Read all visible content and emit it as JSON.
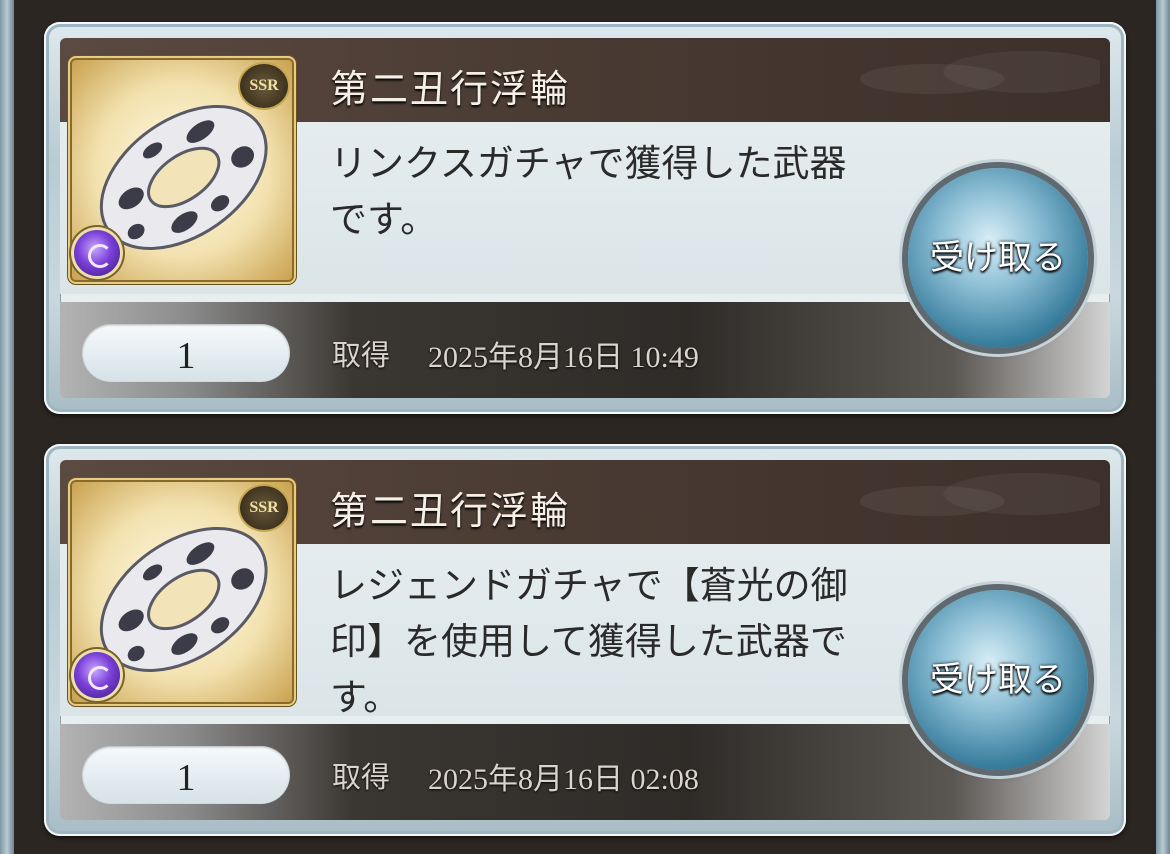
{
  "items": [
    {
      "name": "第二丑行浮輪",
      "rarity": "SSR",
      "element_icon": "dark-element-icon",
      "description": "リンクスガチャで獲得した武器です。",
      "quantity": "1",
      "obtain_label": "取得",
      "obtain_date": "2025年8月16日 10:49",
      "button_label": "受け取る"
    },
    {
      "name": "第二丑行浮輪",
      "rarity": "SSR",
      "element_icon": "dark-element-icon",
      "description": "レジェンドガチャで【蒼光の御印】を使用して獲得した武器です。",
      "quantity": "1",
      "obtain_label": "取得",
      "obtain_date": "2025年8月16日 02:08",
      "button_label": "受け取る"
    }
  ],
  "colors": {
    "title_bar": "#4a3b33",
    "button_blue": "#3b7f9e",
    "rarity_gold": "#c7a650",
    "element_dark": "#7a3fd8"
  }
}
